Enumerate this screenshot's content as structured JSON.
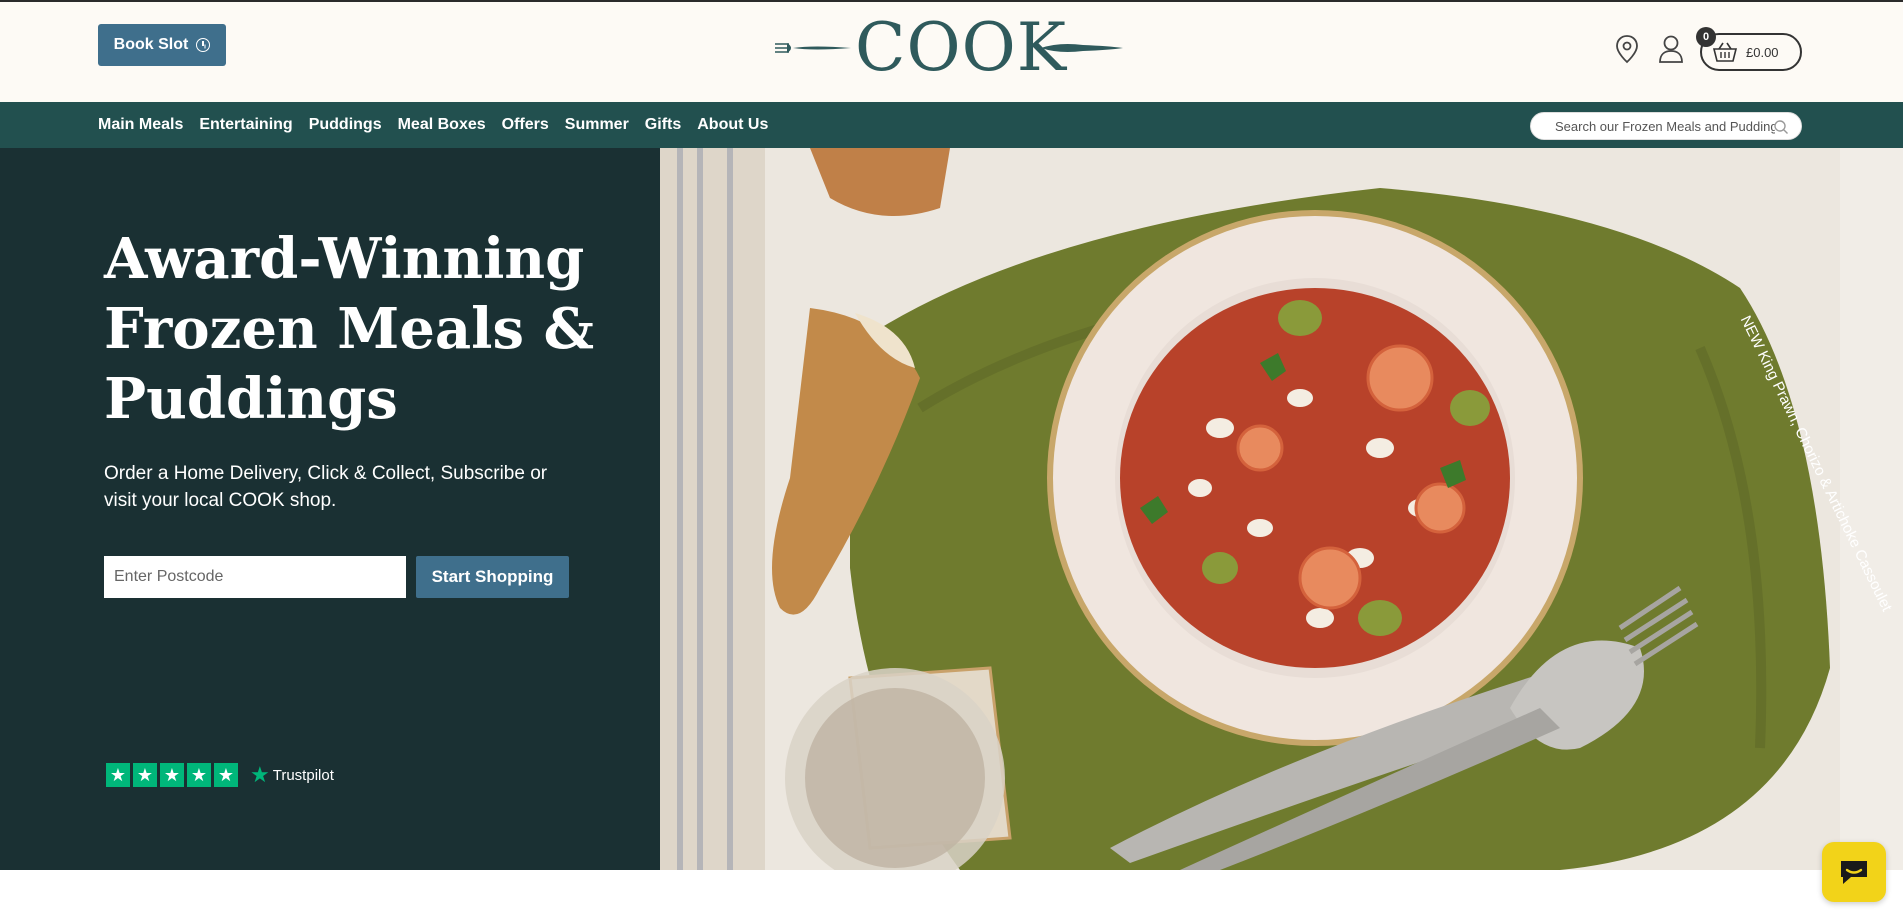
{
  "header": {
    "book_slot_label": "Book Slot",
    "logo_text": "COOK",
    "cart_count": "0",
    "cart_total": "£0.00",
    "icons": [
      "location-pin-icon",
      "user-icon",
      "basket-icon",
      "clock-icon"
    ]
  },
  "nav": {
    "items": [
      "Main Meals",
      "Entertaining",
      "Puddings",
      "Meal Boxes",
      "Offers",
      "Summer",
      "Gifts",
      "About Us"
    ],
    "search_placeholder": "Search our Frozen Meals and Puddings"
  },
  "hero": {
    "title": "Award-Winning Frozen Meals & Puddings",
    "subtitle": "Order a Home Delivery, Click & Collect, Subscribe or visit your local COOK shop.",
    "postcode_placeholder": "Enter Postcode",
    "cta_label": "Start Shopping",
    "photo_caption": "NEW King Prawn, Chorizo & Artichoke Cassoulet",
    "trustpilot_label": "Trustpilot",
    "trustpilot_stars": 5
  },
  "colors": {
    "header_bg": "#fdfaf5",
    "nav_bg": "#22504f",
    "hero_bg": "#1a3033",
    "button": "#3f6f8c",
    "trustpilot_green": "#00b67a",
    "chat_yellow": "#f2d319"
  }
}
